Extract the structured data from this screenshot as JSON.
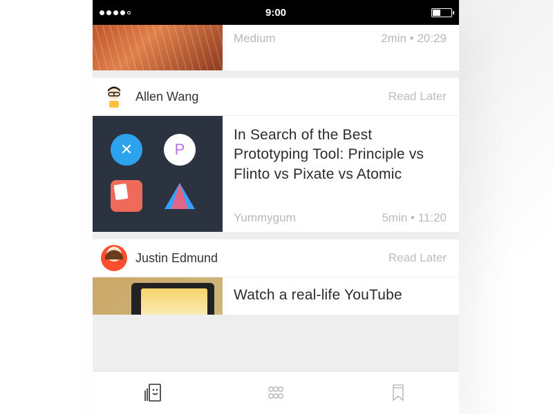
{
  "statusbar": {
    "time": "9:00"
  },
  "feed": [
    {
      "source": "Medium",
      "duration": "2min",
      "time": "20:29"
    },
    {
      "author": "Allen Wang",
      "read_later": "Read Later",
      "title": "In Search of the Best Prototyping Tool: Principle vs Flinto vs Pixate vs Atomic",
      "source": "Yummygum",
      "duration": "5min",
      "time": "11:20"
    },
    {
      "author": "Justin Edmund",
      "read_later": "Read Later",
      "title": "Watch a real-life YouTube"
    }
  ],
  "tabs": {
    "feed": "feed",
    "discover": "discover",
    "bookmarks": "bookmarks"
  }
}
